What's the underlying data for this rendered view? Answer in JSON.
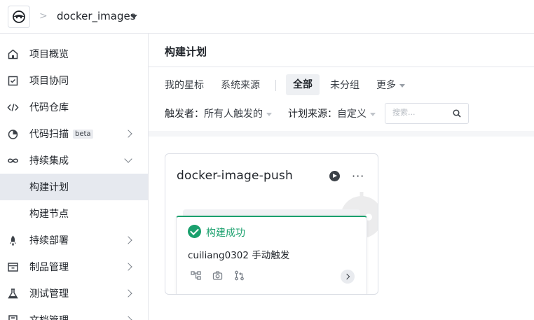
{
  "header": {
    "project_name": "docker_images",
    "breadcrumb_separator": ">"
  },
  "sidebar": {
    "items": [
      {
        "label": "项目概览",
        "icon": "home-icon"
      },
      {
        "label": "项目协同",
        "icon": "checkbox-icon"
      },
      {
        "label": "代码仓库",
        "icon": "code-icon"
      },
      {
        "label": "代码扫描",
        "icon": "scan-icon",
        "badge": "beta"
      },
      {
        "label": "持续集成",
        "icon": "infinity-icon"
      },
      {
        "label": "构建计划"
      },
      {
        "label": "构建节点"
      },
      {
        "label": "持续部署",
        "icon": "rocket-icon"
      },
      {
        "label": "制品管理",
        "icon": "box-icon"
      },
      {
        "label": "测试管理",
        "icon": "flask-icon"
      },
      {
        "label": "文档管理",
        "icon": "book-icon"
      }
    ]
  },
  "main": {
    "title": "构建计划",
    "tabs": [
      "我的星标",
      "系统来源",
      "全部",
      "未分组",
      "更多"
    ],
    "filters": {
      "trigger_label": "触发者：",
      "trigger_value": "所有人触发的",
      "source_label": "计划来源：",
      "source_value": "自定义",
      "search_placeholder": "搜索..."
    },
    "plan": {
      "name": "docker-image-push",
      "more": "···",
      "status": "构建成功",
      "run_info": "cuiliang0302 手动触发"
    }
  },
  "colors": {
    "success": "#1aa06d",
    "active_nav": "#e6e9ef",
    "border": "#e5e6eb"
  }
}
